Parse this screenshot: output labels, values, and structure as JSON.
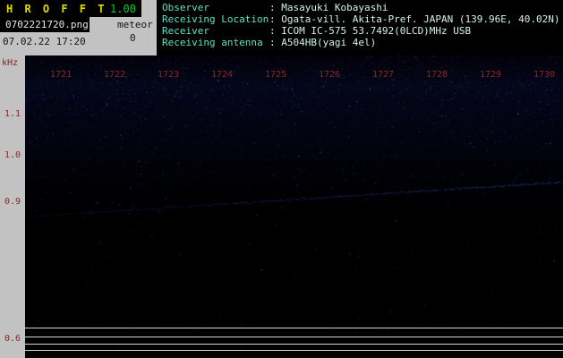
{
  "colors": {
    "page-bg": "#c2c2c2",
    "panel-black": "#000000",
    "title-yellow": "#e0dc00",
    "version-green": "#00cc33",
    "filename-white": "#e8e8e8",
    "meta-black": "#141414",
    "header-label": "#5fe0c4",
    "header-value": "#d4f2e6",
    "axis-maroon": "#8b2626",
    "grid-line": "#d4d4d4",
    "noise-blue": "#2a3cb4",
    "carrier-blue": "#3a52d8"
  },
  "titlebar": {
    "app_title": "H R O F F T",
    "version": "1.00",
    "filename": "0702221720.png",
    "meteor_label": "meteor",
    "meteor_count": "0",
    "datetime": "07.02.22 17:20"
  },
  "header": {
    "rows": [
      {
        "label": "Observer",
        "value": ": Masayuki Kobayashi"
      },
      {
        "label": "Receiving Location",
        "value": ": Ogata-vill. Akita-Pref. JAPAN (139.96E, 40.02N)"
      },
      {
        "label": "Receiver",
        "value": ": ICOM IC-575 53.7492(0LCD)MHz USB"
      },
      {
        "label": "Receiving antenna",
        "value": ": A504HB(yagi 4el)"
      }
    ]
  },
  "spectrogram": {
    "y_axis_unit": "kHz",
    "x_ticks": [
      "1721",
      "1722",
      "1723",
      "1724",
      "1725",
      "1726",
      "1727",
      "1728",
      "1729",
      "1730"
    ],
    "y_ticks": [
      "1.1",
      "1.0",
      "0.9",
      "0.6"
    ],
    "carrier_trace": {
      "description": "faint blue carrier line drifting upward from left to right",
      "approx_start_khz": 0.88,
      "approx_end_khz": 0.96
    }
  }
}
